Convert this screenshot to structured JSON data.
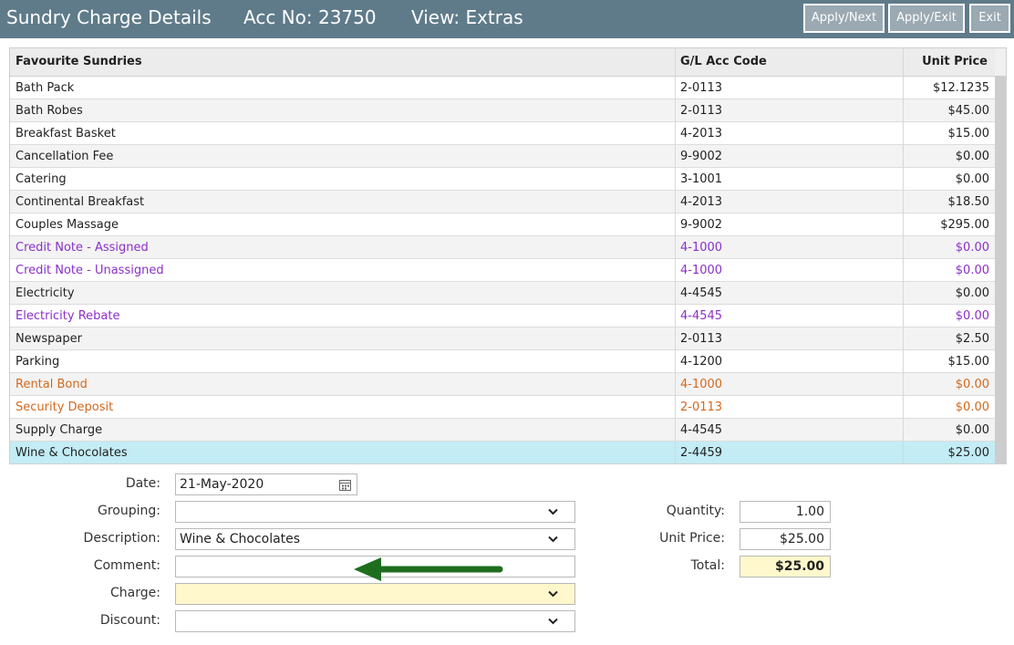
{
  "header": {
    "title": "Sundry Charge Details",
    "acc": "Acc No: 23750",
    "view": "View: Extras",
    "buttons": [
      "Apply/Next",
      "Apply/Exit",
      "Exit"
    ]
  },
  "table": {
    "columns": [
      "Favourite Sundries",
      "G/L Acc Code",
      "Unit Price"
    ],
    "rows": [
      {
        "name": "Bath Pack",
        "code": "2-0113",
        "price": "$12.1235",
        "color": "#222222"
      },
      {
        "name": "Bath Robes",
        "code": "2-0113",
        "price": "$45.00",
        "color": "#222222"
      },
      {
        "name": "Breakfast Basket",
        "code": "4-2013",
        "price": "$15.00",
        "color": "#222222"
      },
      {
        "name": "Cancellation Fee",
        "code": "9-9002",
        "price": "$0.00",
        "color": "#222222"
      },
      {
        "name": "Catering",
        "code": "3-1001",
        "price": "$0.00",
        "color": "#222222"
      },
      {
        "name": "Continental Breakfast",
        "code": "4-2013",
        "price": "$18.50",
        "color": "#222222"
      },
      {
        "name": "Couples Massage",
        "code": "9-9002",
        "price": "$295.00",
        "color": "#222222"
      },
      {
        "name": "Credit Note - Assigned",
        "code": "4-1000",
        "price": "$0.00",
        "color": "#8b2fc9"
      },
      {
        "name": "Credit Note - Unassigned",
        "code": "4-1000",
        "price": "$0.00",
        "color": "#8b2fc9"
      },
      {
        "name": "Electricity",
        "code": "4-4545",
        "price": "$0.00",
        "color": "#222222"
      },
      {
        "name": "Electricity Rebate",
        "code": "4-4545",
        "price": "$0.00",
        "color": "#8b2fc9"
      },
      {
        "name": "Newspaper",
        "code": "2-0113",
        "price": "$2.50",
        "color": "#222222"
      },
      {
        "name": "Parking",
        "code": "4-1200",
        "price": "$15.00",
        "color": "#222222"
      },
      {
        "name": "Rental Bond",
        "code": "4-1000",
        "price": "$0.00",
        "color": "#d2691e"
      },
      {
        "name": "Security Deposit",
        "code": "2-0113",
        "price": "$0.00",
        "color": "#d2691e"
      },
      {
        "name": "Supply Charge",
        "code": "4-4545",
        "price": "$0.00",
        "color": "#222222"
      },
      {
        "name": "Wine & Chocolates",
        "code": "2-4459",
        "price": "$25.00",
        "color": "#222222",
        "selected": true
      }
    ]
  },
  "form": {
    "date_label": "Date:",
    "date_value": "21-May-2020",
    "grouping_label": "Grouping:",
    "grouping_value": "",
    "description_label": "Description:",
    "description_value": "Wine & Chocolates",
    "comment_label": "Comment:",
    "comment_value": "",
    "charge_label": "Charge:",
    "charge_value": "",
    "discount_label": "Discount:",
    "discount_value": "",
    "quantity_label": "Quantity:",
    "quantity_value": "1.00",
    "unit_price_label": "Unit Price:",
    "unit_price_value": "$25.00",
    "total_label": "Total:",
    "total_value": "$25.00"
  },
  "colors": {
    "titlebar": "#5f7b8a",
    "selected_row": "#c3ecf5",
    "highlight_field": "#fff8cc",
    "arrow": "#1f6e1f"
  }
}
